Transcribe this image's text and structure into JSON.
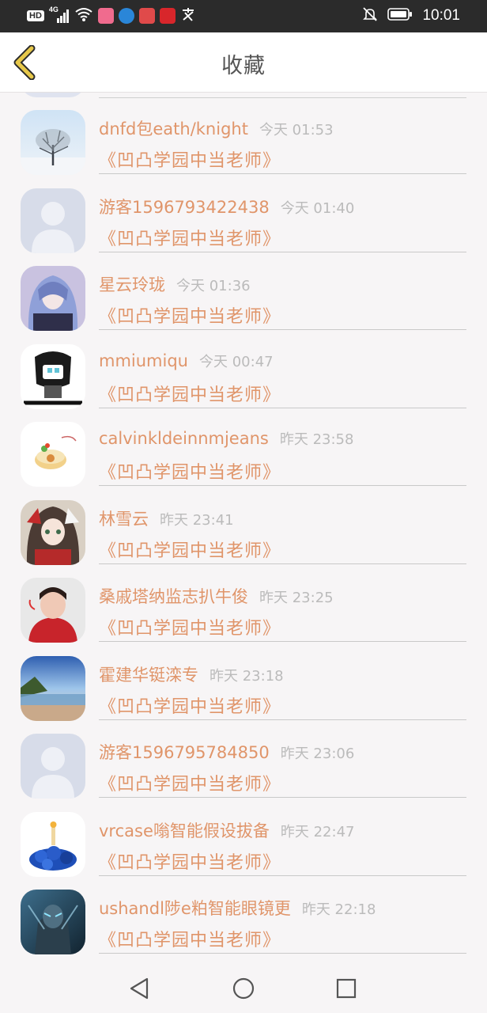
{
  "status_bar": {
    "left_icons": [
      "hd-icon",
      "signal-4g-icon",
      "wifi-icon",
      "app-notification-icons"
    ],
    "hd_label": "HD",
    "network_label": "4G",
    "right_icons": [
      "mute-bell-icon",
      "battery-icon"
    ],
    "time": "10:01"
  },
  "header": {
    "title": "收藏",
    "back_icon": "chevron-left-icon",
    "accent_color": "#e7c84a"
  },
  "colors": {
    "name": "#e0956a",
    "time": "#bbbbbb",
    "divider": "#c9c9c9",
    "background": "#f7f5f6"
  },
  "items": [
    {
      "name": "dnfd包eath/knight",
      "time": "今天 01:53",
      "message": "《凹凸学园中当老师》",
      "avatar": "snow-tree"
    },
    {
      "name": "游客1596793422438",
      "time": "今天 01:40",
      "message": "《凹凸学园中当老师》",
      "avatar": "default-user"
    },
    {
      "name": "星云玲珑",
      "time": "今天 01:36",
      "message": "《凹凸学园中当老师》",
      "avatar": "anime-girl-blue"
    },
    {
      "name": "mmiumiqu",
      "time": "今天 00:47",
      "message": "《凹凸学园中当老师》",
      "avatar": "meme-cartoon"
    },
    {
      "name": "calvinkldeinnmjeans",
      "time": "昨天 23:58",
      "message": "《凹凸学园中当老师》",
      "avatar": "cake-sketch"
    },
    {
      "name": "林雪云",
      "time": "昨天 23:41",
      "message": "《凹凸学园中当老师》",
      "avatar": "anime-girl-red"
    },
    {
      "name": "桑戚塔纳监志扒牛俊",
      "time": "昨天 23:25",
      "message": "《凹凸学园中当老师》",
      "avatar": "photo-person-red"
    },
    {
      "name": "霍建华铤滦专",
      "time": "昨天 23:18",
      "message": "《凹凸学园中当老师》",
      "avatar": "lake-landscape"
    },
    {
      "name": "游客1596795784850",
      "time": "昨天 23:06",
      "message": "《凹凸学园中当老师》",
      "avatar": "default-user"
    },
    {
      "name": "vrcase嗡智能假设拔备",
      "time": "昨天 22:47",
      "message": "《凹凸学园中当老师》",
      "avatar": "blue-stones"
    },
    {
      "name": "ushandl陟e粕智能眼镜更",
      "time": "昨天 22:18",
      "message": "《凹凸学园中当老师》",
      "avatar": "armored-warrior"
    }
  ],
  "nav_bar": {
    "back_icon": "triangle-back-icon",
    "home_icon": "circle-home-icon",
    "recents_icon": "square-recents-icon"
  }
}
